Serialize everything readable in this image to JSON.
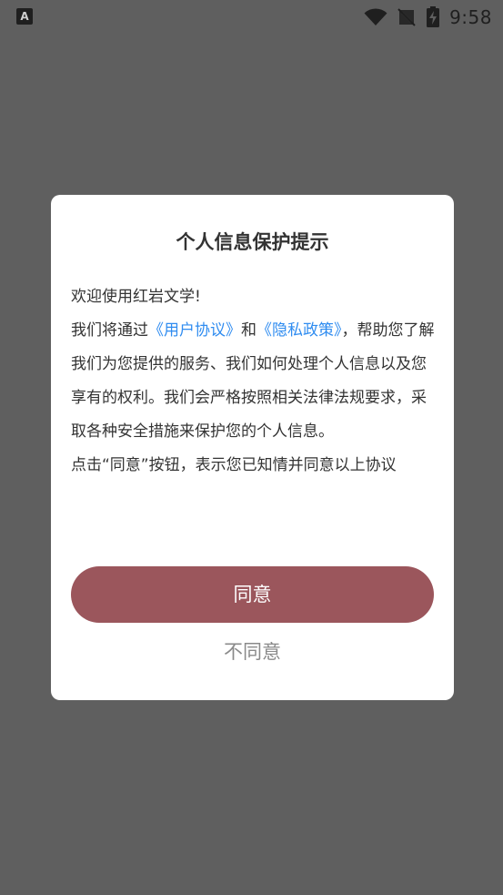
{
  "status_bar": {
    "left_icon_letter": "A",
    "time": "9:58",
    "icons": [
      "wifi-icon",
      "no-signal-icon",
      "battery-charging-icon"
    ]
  },
  "dialog": {
    "title": "个人信息保护提示",
    "welcome": "欢迎使用红岩文学!",
    "para1_prefix": "我们将通过",
    "user_agreement_link": "《用户协议》",
    "and": "和",
    "privacy_policy_link": "《隐私政策》",
    "para1_suffix": "，帮助您了解我们为您提供的服务、我们如何处理个人信息以及您享有的权利。我们会严格按照相关法律法规要求，采取各种安全措施来保护您的个人信息。",
    "para2": "点击“同意”按钮，表示您已知情并同意以上协议",
    "agree_label": "同意",
    "disagree_label": "不同意"
  },
  "colors": {
    "backdrop": "#5f5f5f",
    "dialog_bg": "#ffffff",
    "primary_button": "#9b565c",
    "link": "#2f8cf0",
    "text": "#333333",
    "secondary_text": "#8a8a8a"
  }
}
